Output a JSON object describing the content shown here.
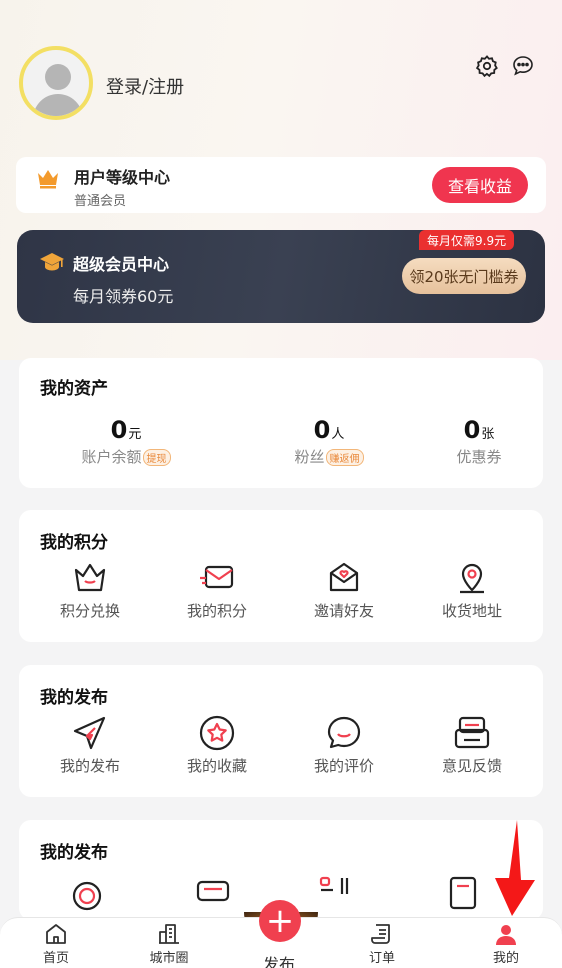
{
  "header": {
    "login_text": "登录/注册",
    "icons": [
      "settings-icon",
      "message-icon"
    ]
  },
  "level": {
    "title": "用户等级中心",
    "subtitle": "普通会员",
    "button": "查看收益"
  },
  "vip": {
    "title": "超级会员中心",
    "subtitle": "每月领券60元",
    "badge": "每月仅需9.9元",
    "button": "领20张无门槛券"
  },
  "assets": {
    "title": "我的资产",
    "items": [
      {
        "value": "0",
        "unit": "元",
        "label": "账户余额",
        "tag": "提现"
      },
      {
        "value": "0",
        "unit": "人",
        "label": "粉丝",
        "tag": "赚返佣"
      },
      {
        "value": "0",
        "unit": "张",
        "label": "优惠券",
        "tag": ""
      }
    ]
  },
  "points": {
    "title": "我的积分",
    "items": [
      {
        "label": "积分兑换",
        "icon": "crown-icon"
      },
      {
        "label": "我的积分",
        "icon": "envelope-icon"
      },
      {
        "label": "邀请好友",
        "icon": "invite-icon"
      },
      {
        "label": "收货地址",
        "icon": "location-icon"
      }
    ]
  },
  "publish": {
    "title": "我的发布",
    "items": [
      {
        "label": "我的发布",
        "icon": "paper-plane-icon"
      },
      {
        "label": "我的收藏",
        "icon": "star-icon"
      },
      {
        "label": "我的评价",
        "icon": "comment-icon"
      },
      {
        "label": "意见反馈",
        "icon": "feedback-icon"
      }
    ]
  },
  "publish2": {
    "title": "我的发布"
  },
  "tabbar": {
    "items": [
      {
        "label": "首页",
        "icon": "home-icon"
      },
      {
        "label": "城市圈",
        "icon": "city-icon"
      },
      {
        "label": "发布",
        "icon": "plus-icon"
      },
      {
        "label": "订单",
        "icon": "order-icon"
      },
      {
        "label": "我的",
        "icon": "user-icon"
      }
    ]
  },
  "colors": {
    "accent": "#f0354f",
    "vip_bg": "#2f3546",
    "gold": "#e6c19c"
  }
}
